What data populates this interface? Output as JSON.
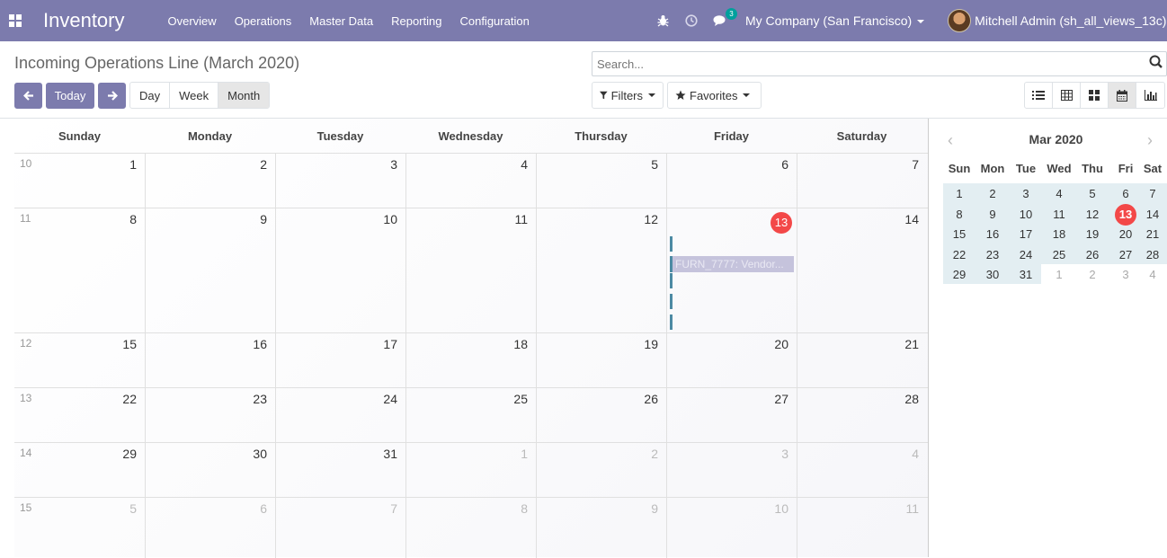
{
  "navbar": {
    "app_name": "Inventory",
    "menu": [
      "Overview",
      "Operations",
      "Master Data",
      "Reporting",
      "Configuration"
    ],
    "chat_count": "3",
    "company": "My Company (San Francisco)",
    "user": "Mitchell Admin (sh_all_views_13c)",
    "color": "#7c7bad"
  },
  "control": {
    "title": "Incoming Operations Line (March 2020)",
    "today_label": "Today",
    "scales": [
      "Day",
      "Week",
      "Month"
    ],
    "active_scale": "Month",
    "search_placeholder": "Search...",
    "filters_label": "Filters",
    "favorites_label": "Favorites",
    "views": [
      "list-icon",
      "pivot-table-icon",
      "kanban-icon",
      "calendar-icon",
      "graph-icon"
    ],
    "active_view": "calendar-icon"
  },
  "calendar": {
    "weekdays": [
      "Sunday",
      "Monday",
      "Tuesday",
      "Wednesday",
      "Thursday",
      "Friday",
      "Saturday"
    ],
    "weeks": [
      {
        "num": "10",
        "days": [
          "1",
          "2",
          "3",
          "4",
          "5",
          "6",
          "7"
        ],
        "other": [
          false,
          false,
          false,
          false,
          false,
          false,
          false
        ]
      },
      {
        "num": "11",
        "days": [
          "8",
          "9",
          "10",
          "11",
          "12",
          "13",
          "14"
        ],
        "other": [
          false,
          false,
          false,
          false,
          false,
          false,
          false
        ]
      },
      {
        "num": "12",
        "days": [
          "15",
          "16",
          "17",
          "18",
          "19",
          "20",
          "21"
        ],
        "other": [
          false,
          false,
          false,
          false,
          false,
          false,
          false
        ]
      },
      {
        "num": "13",
        "days": [
          "22",
          "23",
          "24",
          "25",
          "26",
          "27",
          "28"
        ],
        "other": [
          false,
          false,
          false,
          false,
          false,
          false,
          false
        ]
      },
      {
        "num": "14",
        "days": [
          "29",
          "30",
          "31",
          "1",
          "2",
          "3",
          "4"
        ],
        "other": [
          false,
          false,
          false,
          true,
          true,
          true,
          true
        ]
      },
      {
        "num": "15",
        "days": [
          "5",
          "6",
          "7",
          "8",
          "9",
          "10",
          "11"
        ],
        "other": [
          true,
          true,
          true,
          true,
          true,
          true,
          true
        ]
      }
    ],
    "today": "13",
    "event_label": "FURN_7777: Vendor...",
    "today_color": "#f34848",
    "event_color": "#4c8aa3"
  },
  "mini": {
    "title": "Mar 2020",
    "weekdays": [
      "Sun",
      "Mon",
      "Tue",
      "Wed",
      "Thu",
      "Fri",
      "Sat"
    ],
    "weeks": [
      {
        "days": [
          "1",
          "2",
          "3",
          "4",
          "5",
          "6",
          "7"
        ],
        "other": [
          false,
          false,
          false,
          false,
          false,
          false,
          false
        ]
      },
      {
        "days": [
          "8",
          "9",
          "10",
          "11",
          "12",
          "13",
          "14"
        ],
        "other": [
          false,
          false,
          false,
          false,
          false,
          false,
          false
        ]
      },
      {
        "days": [
          "15",
          "16",
          "17",
          "18",
          "19",
          "20",
          "21"
        ],
        "other": [
          false,
          false,
          false,
          false,
          false,
          false,
          false
        ]
      },
      {
        "days": [
          "22",
          "23",
          "24",
          "25",
          "26",
          "27",
          "28"
        ],
        "other": [
          false,
          false,
          false,
          false,
          false,
          false,
          false
        ]
      },
      {
        "days": [
          "29",
          "30",
          "31",
          "1",
          "2",
          "3",
          "4"
        ],
        "other": [
          false,
          false,
          false,
          true,
          true,
          true,
          true
        ]
      }
    ],
    "today": "13"
  }
}
